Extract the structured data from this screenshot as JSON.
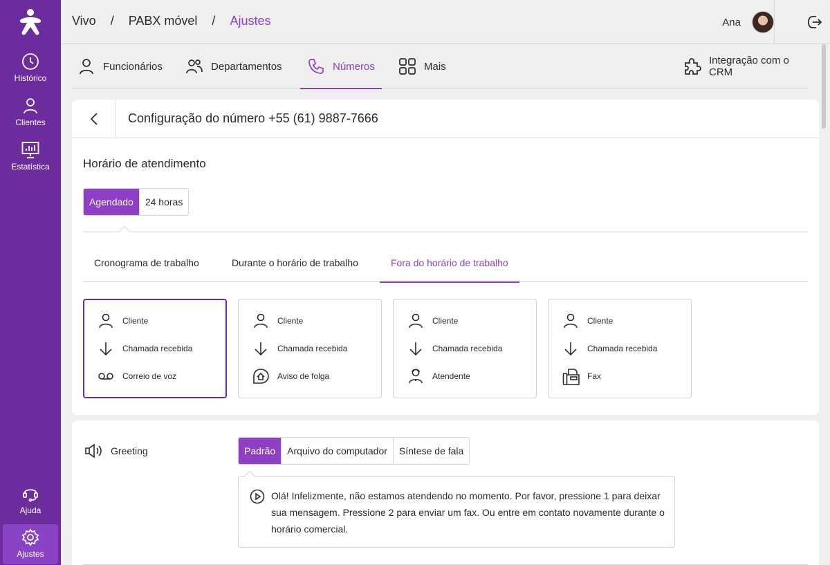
{
  "sidebar": {
    "items": [
      {
        "label": "Histórico",
        "icon": "clock-icon"
      },
      {
        "label": "Clientes",
        "icon": "person-icon"
      },
      {
        "label": "Estatística",
        "icon": "chart-monitor-icon"
      }
    ],
    "bottom": [
      {
        "label": "Ajuda",
        "icon": "headset-icon"
      },
      {
        "label": "Ajustes",
        "icon": "gear-icon",
        "active": true
      }
    ]
  },
  "header": {
    "breadcrumb": [
      "Vivo",
      "PABX móvel",
      "Ajustes"
    ],
    "separator": "/",
    "user_name": "Ana"
  },
  "subnav": {
    "tabs": [
      {
        "label": "Funcionários",
        "icon": "person-icon"
      },
      {
        "label": "Departamentos",
        "icon": "people-icon"
      },
      {
        "label": "Números",
        "icon": "phone-icon",
        "active": true
      },
      {
        "label": "Mais",
        "icon": "grid-icon"
      }
    ],
    "crm": {
      "label": "Integração com o CRM",
      "icon": "puzzle-icon"
    }
  },
  "config": {
    "title": "Configuração do número +55 (61) 9887-7666",
    "section_title": "Horário de atendimento",
    "mode_options": [
      "Agendado",
      "24 horas"
    ],
    "mode_selected": "Agendado",
    "tabs": [
      "Cronograma de trabalho",
      "Durante o horário de trabalho",
      "Fora do horário de trabalho"
    ],
    "tab_active": "Fora do horário de trabalho",
    "scenarios": [
      {
        "rows": [
          "Cliente",
          "Chamada recebida",
          "Correio de voz"
        ],
        "selected": true
      },
      {
        "rows": [
          "Cliente",
          "Chamada recebida",
          "Aviso de folga"
        ]
      },
      {
        "rows": [
          "Cliente",
          "Chamada recebida",
          "Atendente"
        ]
      },
      {
        "rows": [
          "Cliente",
          "Chamada recebida",
          "Fax"
        ]
      }
    ]
  },
  "greeting": {
    "label": "Greeting",
    "options": [
      "Padrão",
      "Arquivo do computador",
      "Síntese de fala"
    ],
    "selected": "Padrão",
    "message": "Olá! Infelizmente, não estamos atendendo no momento. Por favor, pressione 1 para deixar sua mensagem. Pressione 2 para enviar um fax. Ou entre em contato novamente durante o horário comercial."
  },
  "colors": {
    "sidebar": "#6c2c9e",
    "accent": "#8e3fc6",
    "background": "#efefef"
  }
}
